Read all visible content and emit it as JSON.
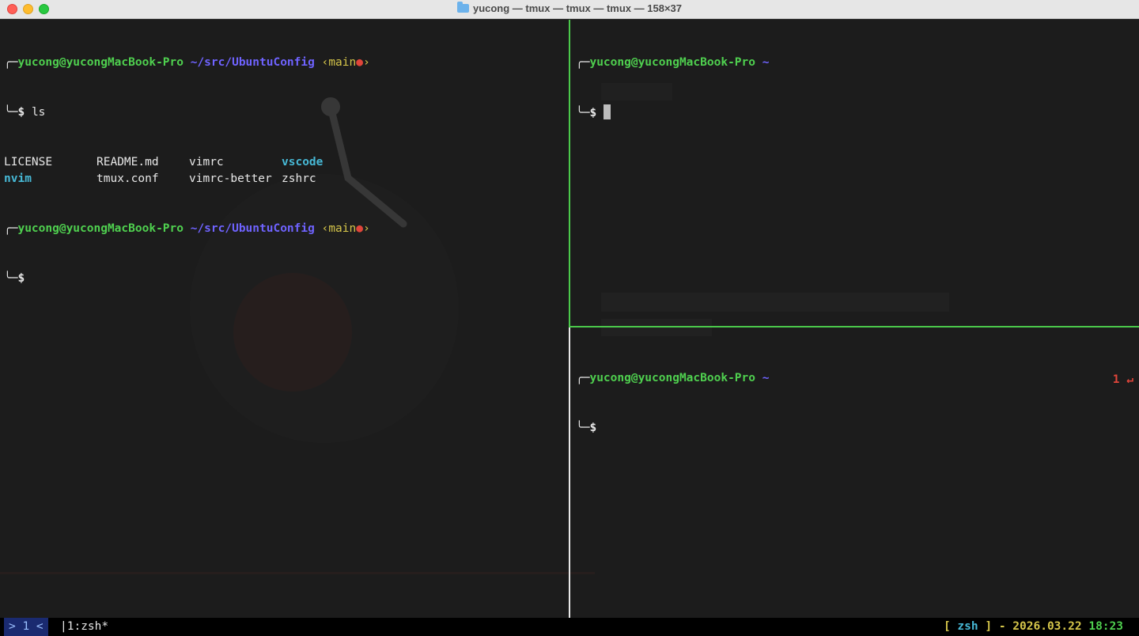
{
  "window": {
    "title": "yucong — tmux — tmux — tmux — 158×37"
  },
  "prompt": {
    "user_host": "yucong@yucongMacBook-Pro",
    "repo_path": "~/src/UbuntuConfig",
    "home_path": "~",
    "branch_open": "‹main",
    "branch_dot": "●",
    "branch_close": "›",
    "top_corner": "╭─",
    "bottom_corner": "╰─",
    "dollar": "$"
  },
  "left_pane": {
    "command": "ls",
    "ls_entries": [
      {
        "name": "LICENSE",
        "type": "file"
      },
      {
        "name": "README.md",
        "type": "file"
      },
      {
        "name": "vimrc",
        "type": "file"
      },
      {
        "name": "vscode",
        "type": "dir"
      },
      {
        "name": "nvim",
        "type": "dir"
      },
      {
        "name": "tmux.conf",
        "type": "file"
      },
      {
        "name": "vimrc-better",
        "type": "file"
      },
      {
        "name": "zshrc",
        "type": "file"
      }
    ]
  },
  "bottom_right_pane": {
    "exit_code": "1",
    "exit_symbol": "↵"
  },
  "statusbar": {
    "session": "> 1 <",
    "window": "|1:zsh*",
    "bracket_open": "[ ",
    "shell": "zsh",
    "bracket_close": " ]",
    "sep": " - ",
    "date": "2026.03.22",
    "time": "18:23"
  },
  "colors": {
    "user": "#4fd04f",
    "path": "#6f63ff",
    "git": "#d6c64a",
    "dir": "#47b9d6",
    "active_border": "#4bc94b",
    "error": "#e0453a"
  }
}
